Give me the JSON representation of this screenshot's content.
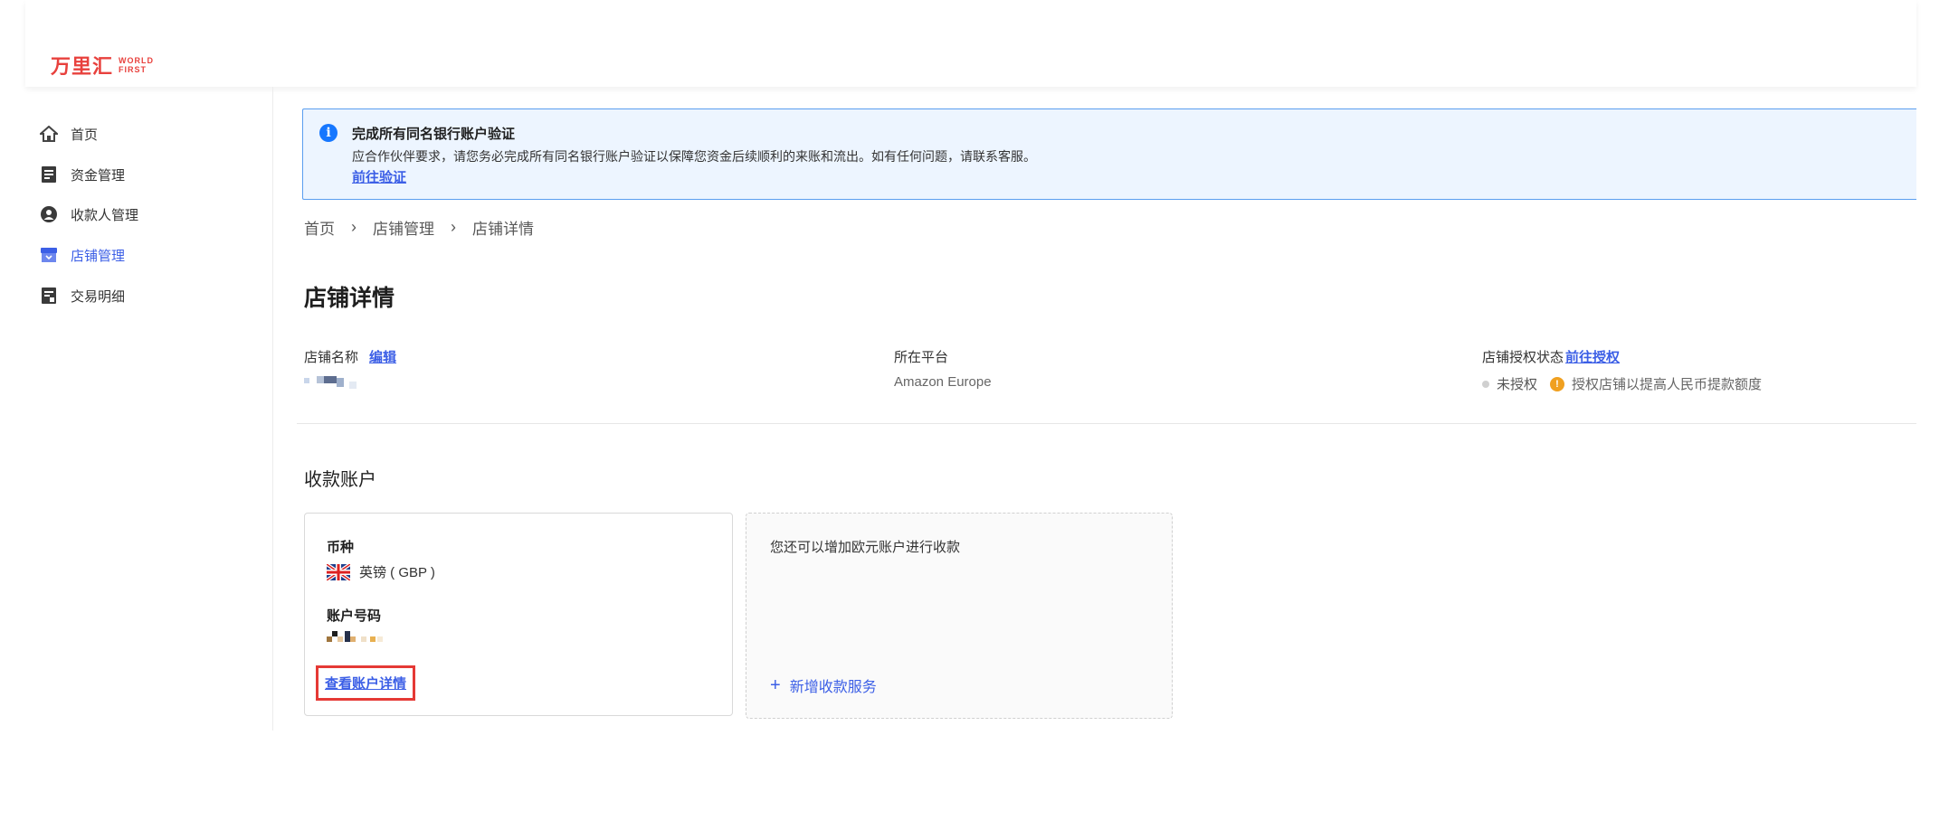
{
  "header": {
    "logo_cn": "万里汇",
    "logo_en_line1": "WORLD",
    "logo_en_line2": "FIRST"
  },
  "sidebar": {
    "items": [
      {
        "label": "首页",
        "icon": "home-icon"
      },
      {
        "label": "资金管理",
        "icon": "document-icon"
      },
      {
        "label": "收款人管理",
        "icon": "user-icon"
      },
      {
        "label": "店铺管理",
        "icon": "store-icon",
        "active": true
      },
      {
        "label": "交易明细",
        "icon": "transactions-icon"
      }
    ],
    "active_color": "#3c5fe6"
  },
  "notice": {
    "title": "完成所有同名银行账户验证",
    "text": "应合作伙伴要求，请您务必完成所有同名银行账户验证以保障您资金后续顺利的来账和流出。如有任何问题，请联系客服。",
    "link": "前往验证"
  },
  "breadcrumb": [
    "首页",
    "店铺管理",
    "店铺详情"
  ],
  "page_title": "店铺详情",
  "store_info": {
    "name_label": "店铺名称",
    "edit_link": "编辑",
    "platform_label": "所在平台",
    "platform_value": "Amazon Europe",
    "auth_label": "店铺授权状态",
    "auth_link": "前往授权",
    "auth_status": "未授权",
    "auth_tip": "授权店铺以提高人民币提款额度"
  },
  "accounts": {
    "section_title": "收款账户",
    "card": {
      "currency_label": "币种",
      "currency_value": "英镑 ( GBP )",
      "account_label": "账户号码",
      "detail_link": "查看账户详情"
    },
    "add_card": {
      "tip": "您还可以增加欧元账户进行收款",
      "button": "新增收款服务"
    }
  }
}
